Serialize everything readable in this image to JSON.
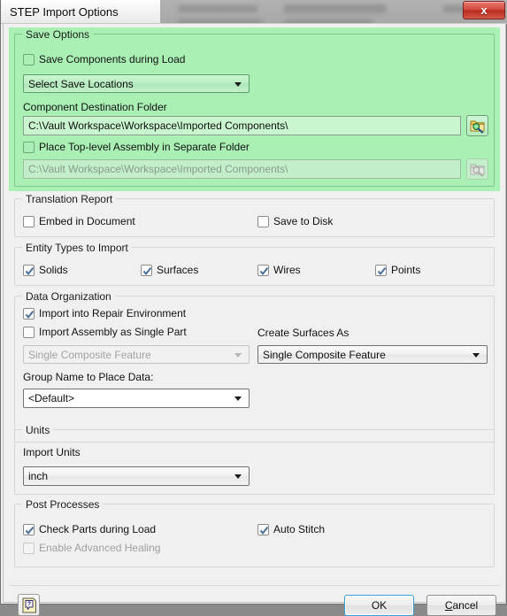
{
  "window": {
    "title": "STEP Import Options",
    "close_label": "x"
  },
  "save_options": {
    "legend": "Save Options",
    "save_components_checkbox": {
      "label": "Save Components during Load",
      "checked": false
    },
    "save_locations_combo": {
      "value": "Select Save Locations"
    },
    "destination_label": "Component Destination Folder",
    "destination_path": {
      "value": "C:\\Vault Workspace\\Workspace\\Imported Components\\"
    },
    "top_level_checkbox": {
      "label": "Place Top-level Assembly in Separate Folder",
      "checked": false
    },
    "top_level_path": {
      "value": "C:\\Vault Workspace\\Workspace\\Imported Components\\",
      "enabled": false
    },
    "browse_icon": "folder-search-icon"
  },
  "translation_report": {
    "legend": "Translation Report",
    "embed_checkbox": {
      "label": "Embed in Document",
      "checked": false
    },
    "save_disk_checkbox": {
      "label": "Save to Disk",
      "checked": false
    }
  },
  "entity_types": {
    "legend": "Entity Types to Import",
    "items": [
      {
        "label": "Solids",
        "checked": true
      },
      {
        "label": "Surfaces",
        "checked": true
      },
      {
        "label": "Wires",
        "checked": true
      },
      {
        "label": "Points",
        "checked": true
      }
    ]
  },
  "data_organization": {
    "legend": "Data Organization",
    "repair_checkbox": {
      "label": "Import into Repair Environment",
      "checked": true
    },
    "single_part_checkbox": {
      "label": "Import Assembly as Single Part",
      "checked": false
    },
    "assembly_combo": {
      "value": "Single Composite Feature",
      "enabled": false
    },
    "create_surfaces_label": "Create Surfaces As",
    "create_surfaces_combo": {
      "value": "Single Composite Feature",
      "enabled": true
    },
    "group_name_label": "Group Name to Place Data:",
    "group_name_combo": {
      "value": "<Default>"
    }
  },
  "units": {
    "legend": "Units",
    "import_units_label": "Import Units",
    "import_units_combo": {
      "value": "inch"
    }
  },
  "post_processes": {
    "legend": "Post Processes",
    "check_parts_checkbox": {
      "label": "Check Parts during Load",
      "checked": true
    },
    "auto_stitch_checkbox": {
      "label": "Auto Stitch",
      "checked": true
    },
    "advanced_healing_checkbox": {
      "label": "Enable Advanced Healing",
      "checked": false,
      "enabled": false
    }
  },
  "footer": {
    "help_icon": "help-icon",
    "ok_label": "OK",
    "cancel_label_prefix": "",
    "cancel_accel": "C",
    "cancel_label_rest": "ancel"
  },
  "colors": {
    "highlight_panel": "#aaf0b4",
    "dialog_background": "#f0f0f0",
    "close_button": "#c8382b",
    "default_button_focus": "#3c9fd6"
  }
}
